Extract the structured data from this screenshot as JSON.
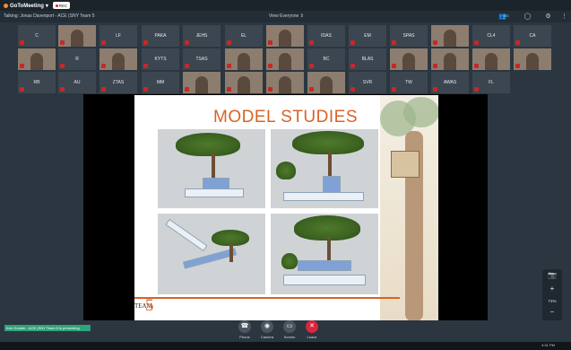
{
  "app": {
    "name": "GoToMeeting",
    "rec_label": "REC"
  },
  "talkbar": {
    "talking": "Talking: Jonas Davenport - ACE (SNY Team 5",
    "view": "View Everyone",
    "attendee_count": "20"
  },
  "participants": [
    {
      "label": "C"
    },
    {
      "label": ""
    },
    {
      "label": "LF"
    },
    {
      "label": "PAKA"
    },
    {
      "label": "JEHS"
    },
    {
      "label": "EL"
    },
    {
      "label": ""
    },
    {
      "label": "IDAS"
    },
    {
      "label": "EM"
    },
    {
      "label": "SPAS"
    },
    {
      "label": ""
    },
    {
      "label": "CL4"
    },
    {
      "label": "CA"
    },
    {
      "label": ""
    },
    {
      "label": "R"
    },
    {
      "label": ""
    },
    {
      "label": "KYTS"
    },
    {
      "label": "TSAS"
    },
    {
      "label": ""
    },
    {
      "label": ""
    },
    {
      "label": "BC"
    },
    {
      "label": "BLAS"
    },
    {
      "label": ""
    },
    {
      "label": ""
    },
    {
      "label": ""
    },
    {
      "label": ""
    },
    {
      "label": "RB"
    },
    {
      "label": "AU"
    },
    {
      "label": "ZTAS"
    },
    {
      "label": "MM"
    },
    {
      "label": ""
    },
    {
      "label": ""
    },
    {
      "label": ""
    },
    {
      "label": ""
    },
    {
      "label": "SVR"
    },
    {
      "label": "TW"
    },
    {
      "label": "AWAS"
    },
    {
      "label": "FL"
    }
  ],
  "slide": {
    "title": "MODEL STUDIES",
    "team_label": "TEAM",
    "team_number": "5"
  },
  "side_controls": {
    "zoom_level": "71%"
  },
  "status": {
    "text": "Ken Goober - ACE (SNY Team 5 is presenting."
  },
  "controls": {
    "phone": "Phone",
    "camera": "Camera",
    "screen": "Screen",
    "leave": "Leave"
  },
  "taskbar": {
    "clock": "4:31 PM"
  },
  "colors": {
    "accent": "#d86327",
    "leave": "#d7263d",
    "status": "#2fa37a"
  }
}
